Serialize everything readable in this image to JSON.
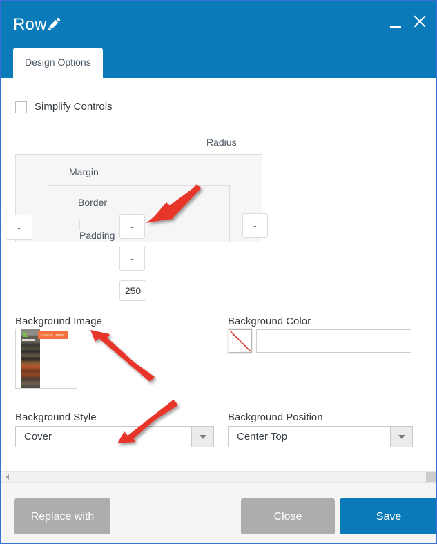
{
  "window": {
    "title": "Row",
    "edit_icon": "pencil-icon",
    "minimize_icon": "minimize-icon",
    "close_icon": "close-icon"
  },
  "tabs": [
    {
      "label": "Design Options",
      "active": true
    }
  ],
  "options": {
    "simplify_controls": {
      "label": "Simplify Controls",
      "checked": false
    }
  },
  "box_model": {
    "labels": {
      "margin": "Margin",
      "border": "Border",
      "padding": "Padding",
      "radius": "Radius"
    },
    "inputs": {
      "top_left": {
        "value": "",
        "placeholder": "-"
      },
      "margin": {
        "value": "",
        "placeholder": "-"
      },
      "radius": {
        "value": "",
        "placeholder": "-"
      },
      "border": {
        "value": "",
        "placeholder": "-"
      },
      "padding": {
        "value": "250",
        "placeholder": "-"
      }
    }
  },
  "background_image": {
    "label": "Background Image",
    "thumbnail_button_text": "CHECK HERE"
  },
  "background_color": {
    "label": "Background Color",
    "swatch_state": "none",
    "value": "",
    "placeholder": ""
  },
  "background_style": {
    "label": "Background Style",
    "value": "Cover",
    "arrow_icon": "chevron-down-icon"
  },
  "background_position": {
    "label": "Background Position",
    "value": "Center Top",
    "arrow_icon": "chevron-down-icon"
  },
  "scrollbar": {
    "left_arrow_icon": "triangle-left-icon",
    "right_arrow_icon": "triangle-right-icon"
  },
  "footer": {
    "replace_with": "Replace with",
    "close": "Close",
    "save": "Save"
  },
  "colors": {
    "accent_blue": "#0a7ab8",
    "gray_button": "#adadad",
    "annotation_red": "#e8352b",
    "panel_gray": "#f6f6f6"
  }
}
